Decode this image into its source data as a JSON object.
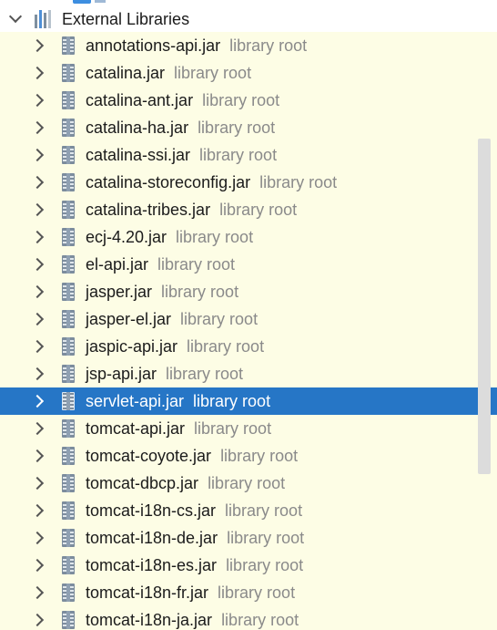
{
  "header": {
    "label": "External Libraries"
  },
  "secondary_text": "library root",
  "selected_index": 13,
  "items": [
    {
      "label": "annotations-api.jar",
      "secondary": "library root"
    },
    {
      "label": "catalina.jar",
      "secondary": "library root"
    },
    {
      "label": "catalina-ant.jar",
      "secondary": "library root"
    },
    {
      "label": "catalina-ha.jar",
      "secondary": "library root"
    },
    {
      "label": "catalina-ssi.jar",
      "secondary": "library root"
    },
    {
      "label": "catalina-storeconfig.jar",
      "secondary": "library root"
    },
    {
      "label": "catalina-tribes.jar",
      "secondary": "library root"
    },
    {
      "label": "ecj-4.20.jar",
      "secondary": "library root"
    },
    {
      "label": "el-api.jar",
      "secondary": "library root"
    },
    {
      "label": "jasper.jar",
      "secondary": "library root"
    },
    {
      "label": "jasper-el.jar",
      "secondary": "library root"
    },
    {
      "label": "jaspic-api.jar",
      "secondary": "library root"
    },
    {
      "label": "jsp-api.jar",
      "secondary": "library root"
    },
    {
      "label": "servlet-api.jar",
      "secondary": "library root"
    },
    {
      "label": "tomcat-api.jar",
      "secondary": "library root"
    },
    {
      "label": "tomcat-coyote.jar",
      "secondary": "library root"
    },
    {
      "label": "tomcat-dbcp.jar",
      "secondary": "library root"
    },
    {
      "label": "tomcat-i18n-cs.jar",
      "secondary": "library root"
    },
    {
      "label": "tomcat-i18n-de.jar",
      "secondary": "library root"
    },
    {
      "label": "tomcat-i18n-es.jar",
      "secondary": "library root"
    },
    {
      "label": "tomcat-i18n-fr.jar",
      "secondary": "library root"
    },
    {
      "label": "tomcat-i18n-ja.jar",
      "secondary": "library root"
    }
  ],
  "icons": {
    "header_expand": "chevron-down-icon",
    "header": "library-icon",
    "row_expand": "chevron-right-icon",
    "row": "jar-icon"
  },
  "colors": {
    "list_background": "#fdfde5",
    "selection": "#2676c6",
    "secondary_text": "#8a8a8a"
  }
}
